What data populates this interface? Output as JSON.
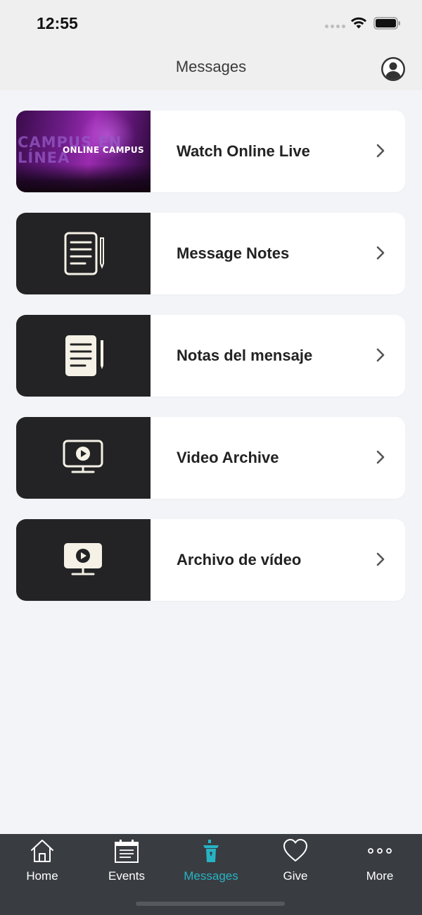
{
  "status_bar": {
    "time": "12:55"
  },
  "header": {
    "title": "Messages",
    "profile_icon": "person-circle-icon"
  },
  "items": [
    {
      "label": "Watch Online Live",
      "thumbnail": {
        "type": "image",
        "bg_text": "CAMPUS EN LÍNEA",
        "overlay_text": "ONLINE CAMPUS"
      }
    },
    {
      "label": "Message Notes",
      "thumbnail": {
        "type": "icon",
        "icon": "notes-outline-icon"
      }
    },
    {
      "label": "Notas del mensaje",
      "thumbnail": {
        "type": "icon",
        "icon": "notes-filled-icon"
      }
    },
    {
      "label": "Video Archive",
      "thumbnail": {
        "type": "icon",
        "icon": "monitor-play-outline-icon"
      }
    },
    {
      "label": "Archivo de vídeo",
      "thumbnail": {
        "type": "icon",
        "icon": "monitor-play-filled-icon"
      }
    }
  ],
  "tabs": [
    {
      "label": "Home",
      "icon": "home-icon",
      "active": false
    },
    {
      "label": "Events",
      "icon": "calendar-icon",
      "active": false
    },
    {
      "label": "Messages",
      "icon": "podium-icon",
      "active": true
    },
    {
      "label": "Give",
      "icon": "heart-icon",
      "active": false
    },
    {
      "label": "More",
      "icon": "more-dots-icon",
      "active": false
    }
  ],
  "colors": {
    "accent": "#27b3c4",
    "tab_bar_bg": "#393c41",
    "thumb_bg": "#232325",
    "page_bg": "#f3f4f8",
    "icon_cream": "#f5f1e6"
  }
}
